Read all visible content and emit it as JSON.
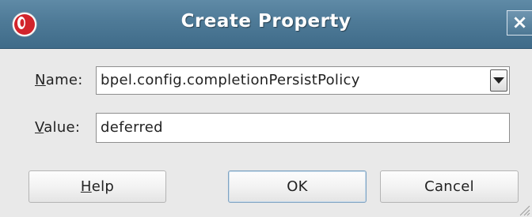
{
  "dialog": {
    "title": "Create Property",
    "close_glyph": "×",
    "icon": "oracle-app-icon"
  },
  "form": {
    "name_label_mnemonic": "N",
    "name_label_rest": "ame:",
    "name_value": "bpel.config.completionPersistPolicy",
    "value_label_mnemonic": "V",
    "value_label_rest": "alue:",
    "value_value": "deferred"
  },
  "buttons": {
    "help_mnemonic": "H",
    "help_rest": "elp",
    "ok": "OK",
    "cancel": "Cancel"
  },
  "colors": {
    "titlebar": "#4e7a97",
    "background": "#e9e9e9",
    "focus_border": "#7fa3c2"
  }
}
